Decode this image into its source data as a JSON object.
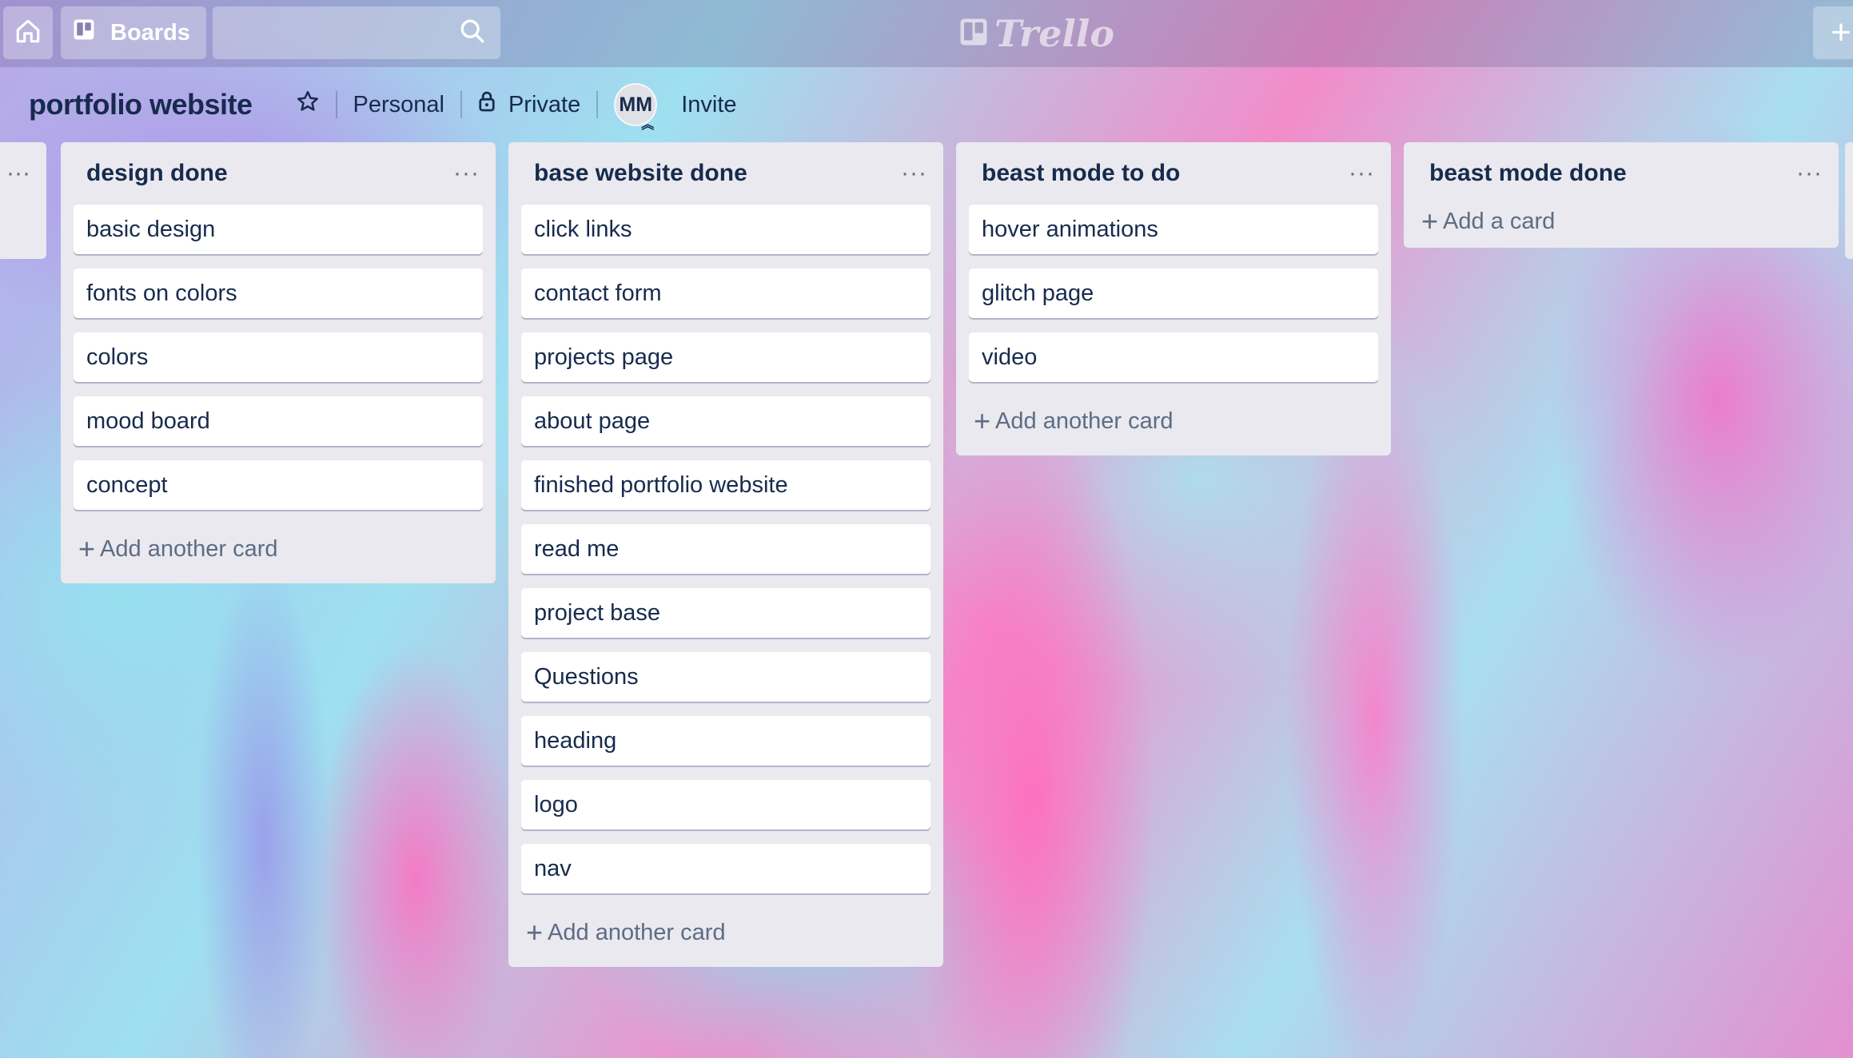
{
  "topbar": {
    "home_icon": "home-icon",
    "boards_label": "Boards",
    "search_value": "",
    "logo_text": "Trello",
    "add_label": "+"
  },
  "header": {
    "board_title": "portfolio website",
    "team_label": "Personal",
    "visibility_label": "Private",
    "member_initials": "MM",
    "invite_label": "Invite"
  },
  "lists": [
    {
      "title": "design done",
      "cards": [
        "basic design",
        "fonts on colors",
        "colors",
        "mood board",
        "concept"
      ],
      "add_label": "Add another card"
    },
    {
      "title": "base website done",
      "cards": [
        "click links",
        "contact form",
        "projects page",
        "about page",
        "finished portfolio website",
        "read me",
        "project base",
        "Questions",
        "heading",
        "logo",
        "nav"
      ],
      "add_label": "Add another card"
    },
    {
      "title": "beast mode to do",
      "cards": [
        "hover animations",
        "glitch page",
        "video"
      ],
      "add_label": "Add another card"
    },
    {
      "title": "beast mode done",
      "cards": [],
      "add_label": "Add a card"
    }
  ],
  "list_menu_glyph": "···",
  "colors": {
    "list_bg": "#e9e9ef",
    "text": "#172b4d",
    "muted": "#5e6c84"
  }
}
